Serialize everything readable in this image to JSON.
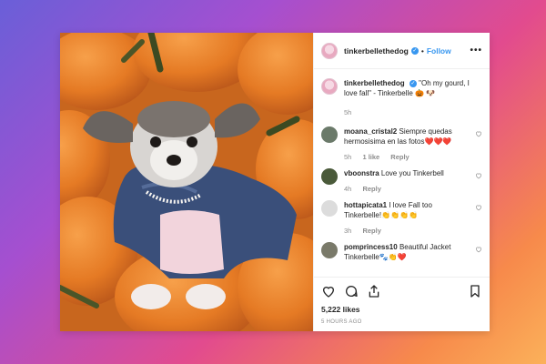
{
  "post": {
    "username": "tinkerbellethedog",
    "verified_mark": "✓",
    "dot": "•",
    "follow_label": "Follow",
    "more_label": "•••"
  },
  "caption": {
    "username": "tinkerbellethedog",
    "text": "\"Oh my gourd, I love fall\" - Tinkerbelle 🎃 🐶",
    "time": "5h"
  },
  "comments": [
    {
      "username": "moana_cristal2",
      "text": "Siempre quedas hermosisima en las fotos❤️❤️❤️",
      "time": "5h",
      "likes": "1 like",
      "reply": "Reply",
      "avatar_color": "#6b7a6a"
    },
    {
      "username": "vboonstra",
      "text": "Love you Tinkerbell",
      "time": "4h",
      "likes": "",
      "reply": "Reply",
      "avatar_color": "#4a5a3a"
    },
    {
      "username": "hottapicata1",
      "text": "I love Fall too Tinkerbelle!👏👏👏👏",
      "time": "3h",
      "likes": "",
      "reply": "Reply",
      "avatar_color": "#dcdcdc"
    },
    {
      "username": "pomprincess10",
      "text": "Beautiful Jacket Tinkerbelle🐾👏❤️",
      "time": "",
      "likes": "",
      "reply": "",
      "avatar_color": "#7a7a6a"
    }
  ],
  "engagement": {
    "likes_count": "5,222 likes",
    "posted_ago": "5 HOURS AGO"
  },
  "icons": [
    "heart-icon",
    "comment-icon",
    "share-icon",
    "bookmark-icon",
    "more-icon"
  ],
  "colors": {
    "accent": "#3897f0",
    "text": "#262626",
    "muted": "#8e8e8e"
  }
}
